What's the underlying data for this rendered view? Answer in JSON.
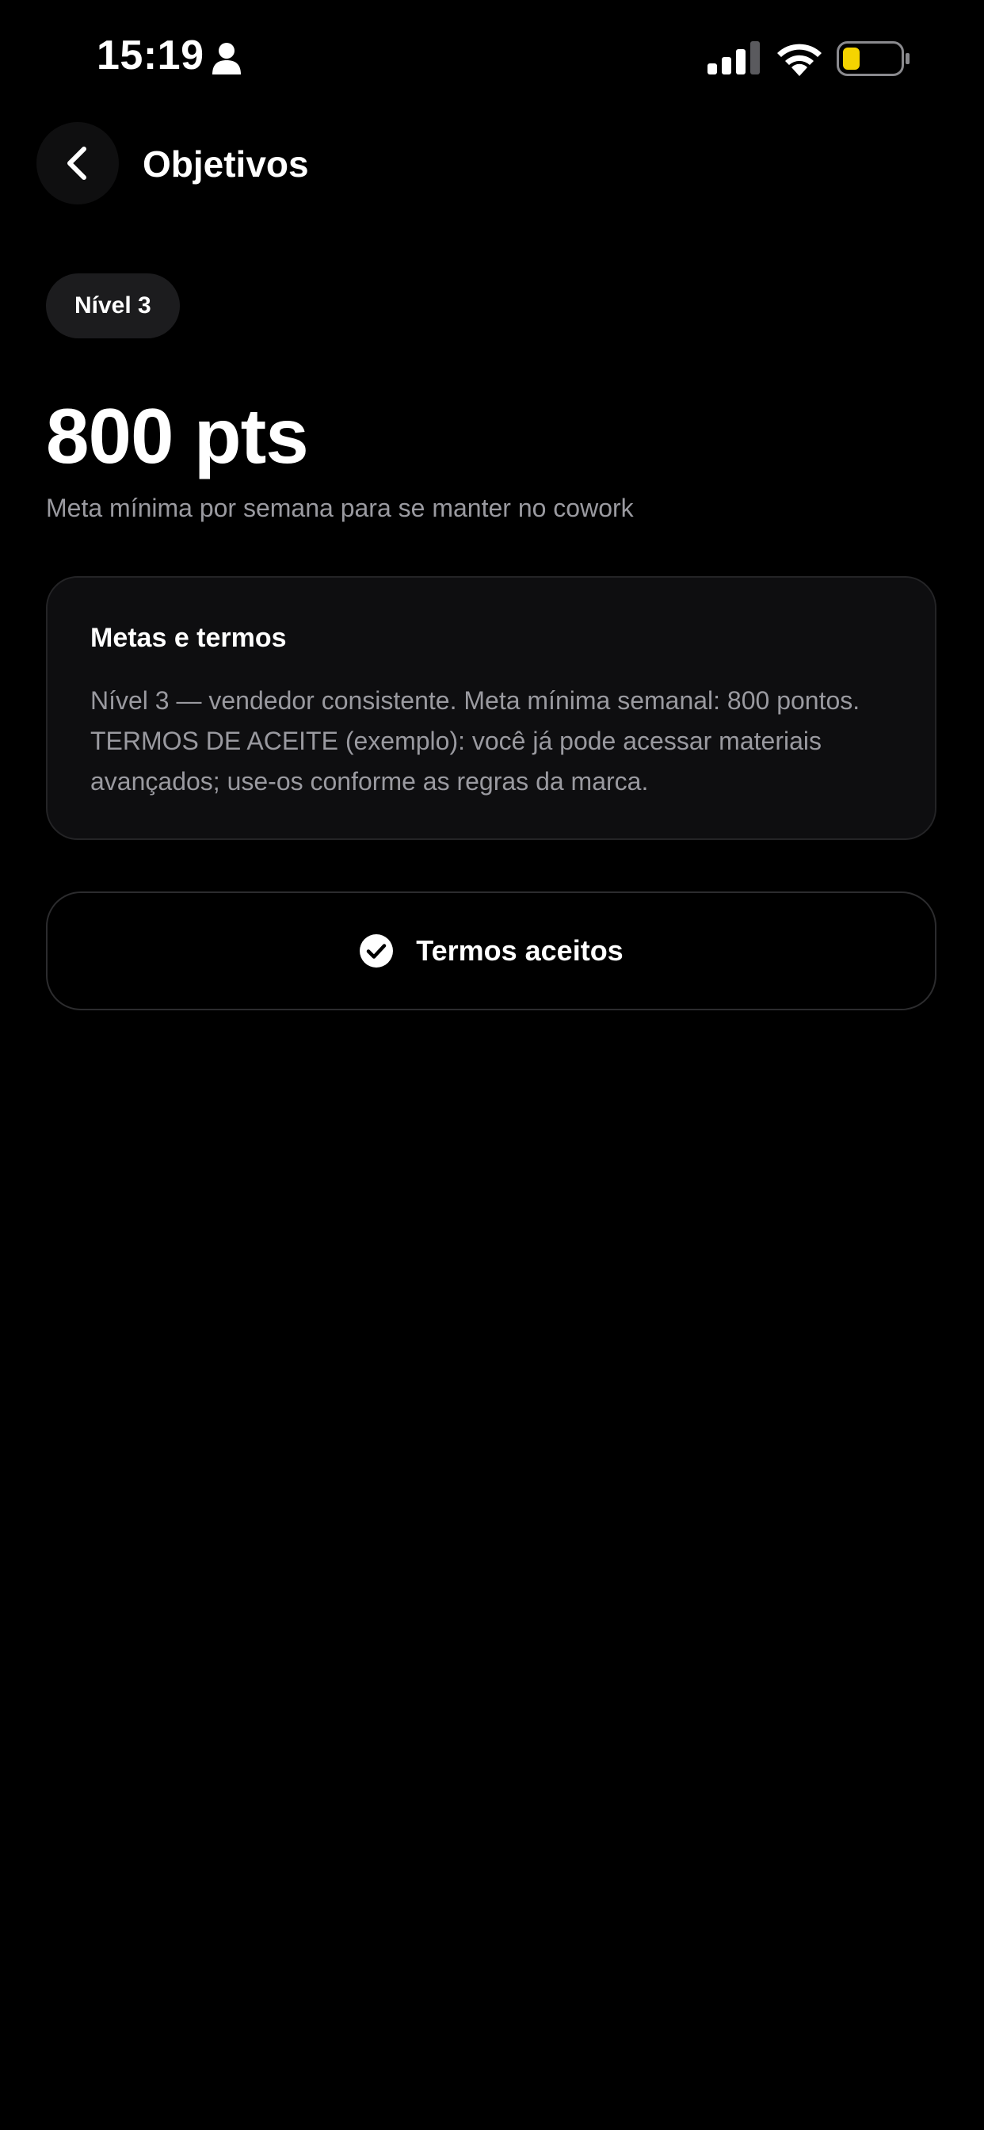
{
  "status_bar": {
    "time": "15:19",
    "icons": [
      "person-icon",
      "cellular-signal-icon",
      "wifi-icon",
      "battery-icon"
    ],
    "battery_level": 0.3,
    "battery_color": "#f5d400"
  },
  "header": {
    "back_icon": "chevron-left-icon",
    "title": "Objetivos"
  },
  "level": {
    "label": "Nível 3"
  },
  "points": {
    "value": "800 pts",
    "caption": "Meta mínima por semana para se manter no cowork"
  },
  "terms_card": {
    "title": "Metas e termos",
    "body": "Nível 3 — vendedor consistente. Meta mínima semanal: 800 pontos. TERMOS DE ACEITE (exemplo): você já pode acessar materiais avançados; use-os conforme as regras da marca."
  },
  "accepted_button": {
    "icon": "check-circle-icon",
    "label": "Termos aceitos"
  },
  "colors": {
    "background": "#000000",
    "text_primary": "#ffffff",
    "text_secondary": "#9a9aa0",
    "card_background": "#0e0e10",
    "chip_background": "#1c1c1e"
  }
}
